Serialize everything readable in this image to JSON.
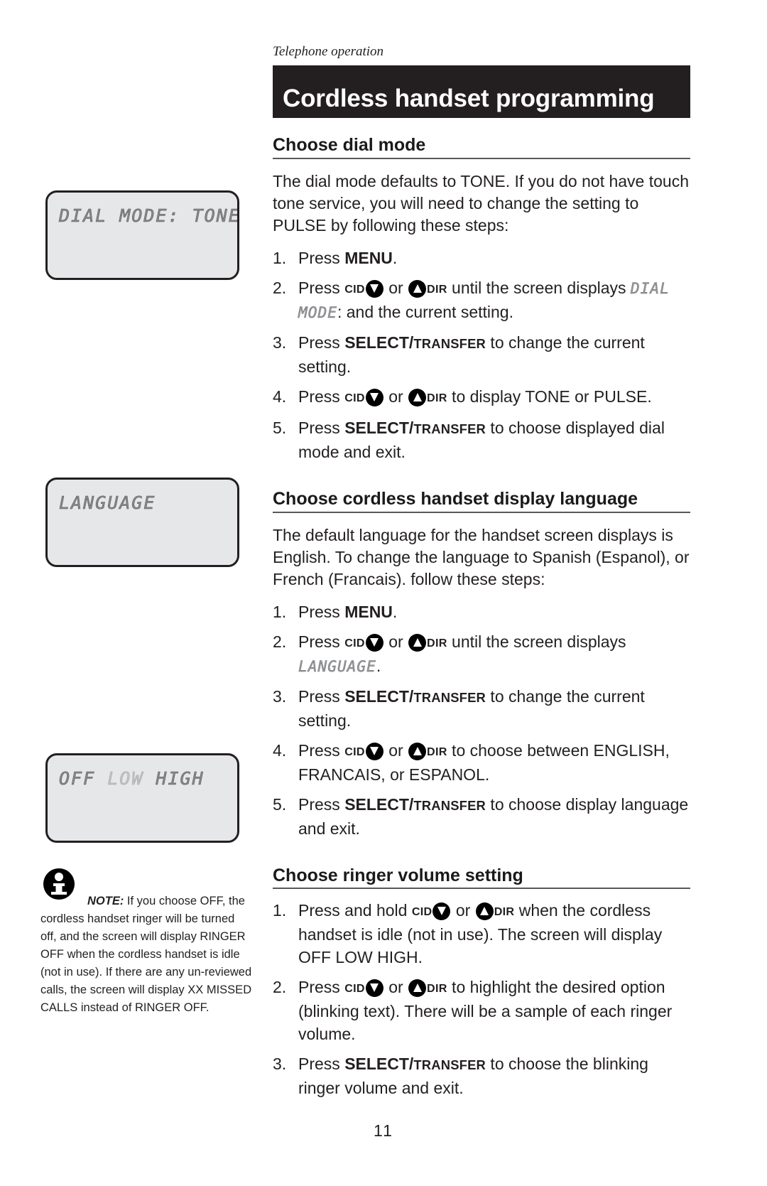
{
  "running_head": "Telephone operation",
  "title": "Cordless handset programming",
  "page_number": "11",
  "lcd_screens": [
    {
      "name": "dial-mode",
      "text": "DIAL MODE: TONE"
    },
    {
      "name": "language",
      "text": "LANGUAGE"
    },
    {
      "name": "ringer-volume",
      "text_before": "OFF ",
      "text_blinking": "LOW",
      "text_after": " HIGH"
    }
  ],
  "sections": [
    {
      "heading": "Choose dial mode",
      "intro": "The dial mode defaults to TONE. If you do not have touch tone service, you will need to change the setting to PULSE by following these steps:",
      "steps": [
        {
          "num": "1.",
          "pre": "Press ",
          "key": "MENU",
          "post": "."
        },
        {
          "num": "2.",
          "pre": "Press ",
          "key_cid": "CID",
          "key_dir": "DIR",
          "mid": " or ",
          "post": " until the screen displays ",
          "lcd": "DIAL MODE",
          "tail": ": and the current setting."
        },
        {
          "num": "3.",
          "pre": "Press ",
          "key": "SELECT/",
          "key_small": "TRANSFER",
          "post": " to change the current setting."
        },
        {
          "num": "4.",
          "pre": "Press ",
          "key_cid": "CID",
          "key_dir": "DIR",
          "mid": " or ",
          "post": " to display TONE or PULSE."
        },
        {
          "num": "5.",
          "pre": "Press ",
          "key": "SELECT/",
          "key_small": "TRANSFER",
          "post": " to choose displayed dial mode and exit."
        }
      ]
    },
    {
      "heading": "Choose cordless handset display language",
      "intro": "The default language for the handset screen displays is English. To change the language to Spanish (Espanol), or French (Francais). follow these steps:",
      "steps": [
        {
          "num": "1.",
          "pre": "Press ",
          "key": "MENU",
          "post": "."
        },
        {
          "num": "2.",
          "pre": "Press ",
          "key_cid": "CID",
          "key_dir": "DIR",
          "mid": " or ",
          "post": " until the screen displays ",
          "lcd": "LANGUAGE",
          "tail": "."
        },
        {
          "num": "3.",
          "pre": "Press ",
          "key": "SELECT/",
          "key_small": "TRANSFER",
          "post": " to change the current setting."
        },
        {
          "num": "4.",
          "pre": "Press ",
          "key_cid": "CID",
          "key_dir": "DIR",
          "mid": " or ",
          "post": " to choose between ENGLISH, FRANCAIS, or ESPANOL."
        },
        {
          "num": "5.",
          "pre": "Press ",
          "key": "SELECT/",
          "key_small": "TRANSFER",
          "post": " to choose display language and exit."
        }
      ]
    },
    {
      "heading": "Choose ringer volume setting",
      "intro": "",
      "steps": [
        {
          "num": "1.",
          "pre": "Press and hold ",
          "key_cid": "CID",
          "key_dir": "DIR",
          "mid": " or ",
          "post": " when the cordless handset is idle (not in use). The screen will display OFF LOW HIGH."
        },
        {
          "num": "2.",
          "pre": "Press ",
          "key_cid": "CID",
          "key_dir": "DIR",
          "mid": " or ",
          "post": " to highlight the desired option (blinking text). There will be a sample of each ringer volume."
        },
        {
          "num": "3.",
          "pre": "Press ",
          "key": "SELECT/",
          "key_small": "TRANSFER",
          "post": " to choose the blinking ringer volume and exit."
        }
      ]
    }
  ],
  "note": {
    "lead": "NOTE:",
    "body": " If you choose OFF, the cordless handset ringer will be turned off, and the screen will display RINGER OFF when the cordless handset is idle (not in use). If there are any un-reviewed calls, the screen will display XX MISSED CALLS instead of RINGER OFF."
  }
}
